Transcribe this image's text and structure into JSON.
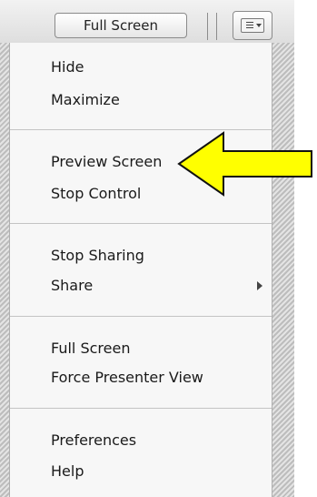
{
  "toolbar": {
    "full_screen_label": "Full Screen",
    "menu_button_icon": "menu-icon"
  },
  "menu": {
    "groups": [
      {
        "items": [
          {
            "label": "Hide"
          },
          {
            "label": "Maximize"
          }
        ]
      },
      {
        "items": [
          {
            "label": "Preview Screen"
          },
          {
            "label": "Stop Control"
          }
        ]
      },
      {
        "items": [
          {
            "label": "Stop Sharing"
          },
          {
            "label": "Share",
            "submenu": true
          }
        ]
      },
      {
        "items": [
          {
            "label": "Full Screen"
          },
          {
            "label": "Force Presenter View"
          }
        ]
      },
      {
        "items": [
          {
            "label": "Preferences"
          },
          {
            "label": "Help"
          }
        ]
      }
    ]
  },
  "annotation": {
    "arrow_color": "#ffff00",
    "points_to": "Preview Screen"
  }
}
